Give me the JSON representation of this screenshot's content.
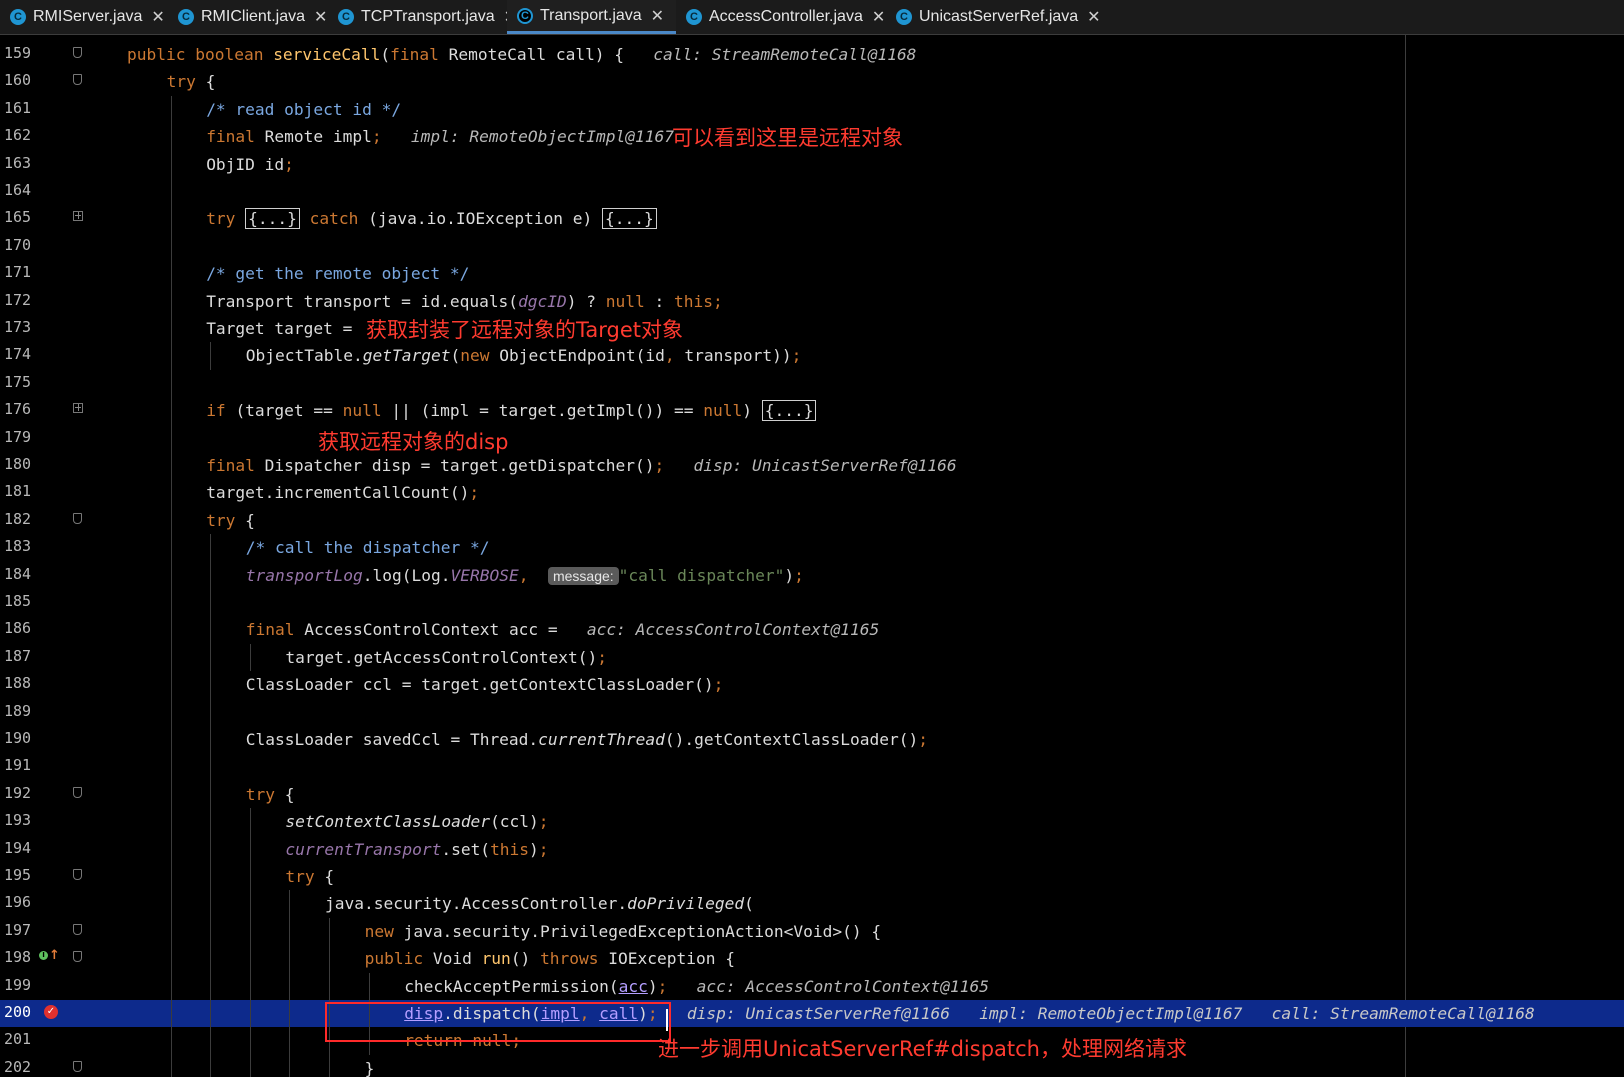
{
  "tabs": [
    {
      "label": "RMIServer.java",
      "icon": "class-icon",
      "active": false
    },
    {
      "label": "RMIClient.java",
      "icon": "class-icon",
      "active": false
    },
    {
      "label": "TCPTransport.java",
      "icon": "class-icon",
      "active": false
    },
    {
      "label": "Transport.java",
      "icon": "abstract-class-icon",
      "active": true
    },
    {
      "label": "AccessController.java",
      "icon": "class-icon",
      "active": false
    },
    {
      "label": "UnicastServerRef.java",
      "icon": "class-icon",
      "active": false
    }
  ],
  "lines": {
    "l159": "159",
    "l160": "160",
    "l161": "161",
    "l162": "162",
    "l163": "163",
    "l164": "164",
    "l165": "165",
    "l170": "170",
    "l171": "171",
    "l172": "172",
    "l173": "173",
    "l174": "174",
    "l175": "175",
    "l176": "176",
    "l179": "179",
    "l180": "180",
    "l181": "181",
    "l182": "182",
    "l183": "183",
    "l184": "184",
    "l185": "185",
    "l186": "186",
    "l187": "187",
    "l188": "188",
    "l189": "189",
    "l190": "190",
    "l191": "191",
    "l192": "192",
    "l193": "193",
    "l194": "194",
    "l195": "195",
    "l196": "196",
    "l197": "197",
    "l198": "198",
    "l199": "199",
    "l200": "200",
    "l201": "201",
    "l202": "202"
  },
  "current_line": "200",
  "hints": {
    "h159": "call: StreamRemoteCall@1168",
    "h162": "impl: RemoteObjectImpl@1167",
    "h180": "disp: UnicastServerRef@1166",
    "h186": "acc: AccessControlContext@1165",
    "h199": "acc: AccessControlContext@1165",
    "h200a": "disp: UnicastServerRef@1166",
    "h200b": "impl: RemoteObjectImpl@1167",
    "h200c": "call: StreamRemoteCall@1168"
  },
  "param_hint": "message:",
  "annotations": {
    "a162": "可以看到这里是远程对象",
    "a173": "获取封装了远程对象的Target对象",
    "a179": "获取远程对象的disp",
    "a201": "进一步调用UnicatServerRef#dispatch，处理网络请求"
  },
  "colors": {
    "keyword": "#cc7832",
    "method": "#ffc66d",
    "string": "#6a8759",
    "static_field": "#9876aa",
    "current_line_bg": "#0d2a8c",
    "annotation": "#ff3b30",
    "breakpoint": "#e0312f"
  }
}
